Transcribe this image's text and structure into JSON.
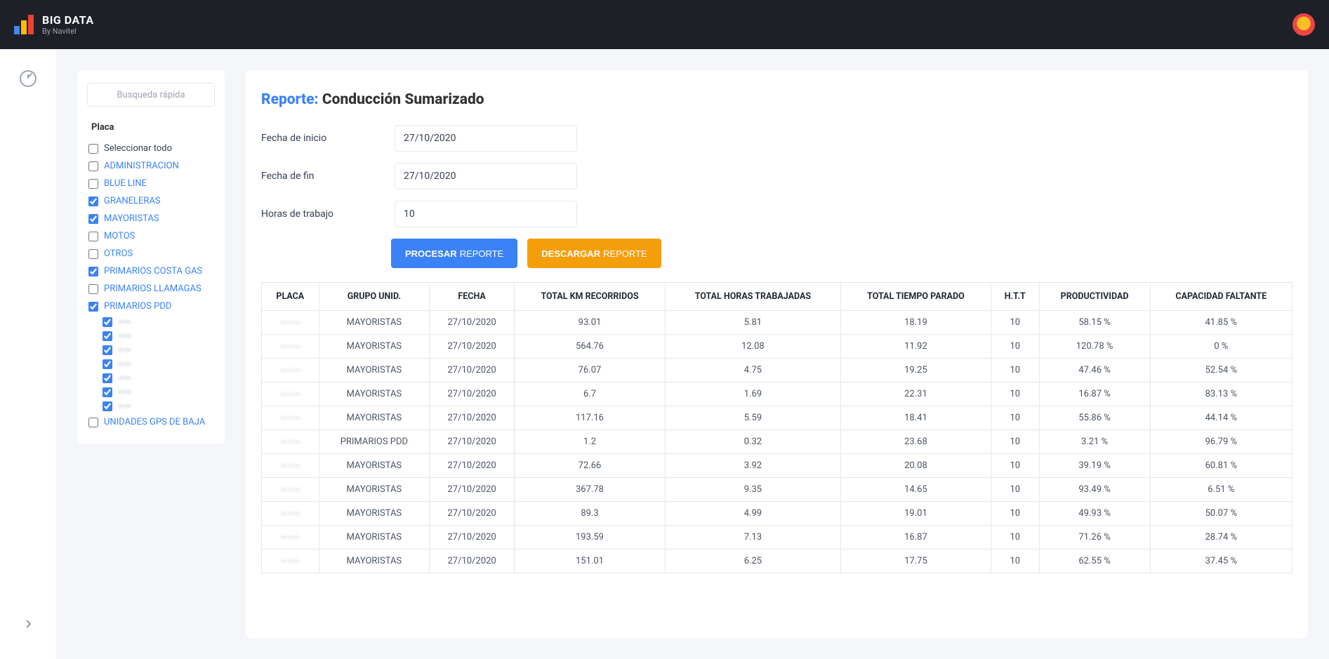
{
  "header": {
    "title": "BIG DATA",
    "subtitle": "By Navitel"
  },
  "search": {
    "placeholder": "Busqueda rápida"
  },
  "filter": {
    "title": "Placa",
    "select_all_label": "Seleccionar todo",
    "items": [
      {
        "label": "ADMINISTRACION",
        "checked": false
      },
      {
        "label": "BLUE LINE",
        "checked": false
      },
      {
        "label": "GRANELERAS",
        "checked": true
      },
      {
        "label": "MAYORISTAS",
        "checked": true
      },
      {
        "label": "MOTOS",
        "checked": false
      },
      {
        "label": "OTROS",
        "checked": false
      },
      {
        "label": "PRIMARIOS COSTA GAS",
        "checked": true
      },
      {
        "label": "PRIMARIOS LLAMAGAS",
        "checked": false
      },
      {
        "label": "PRIMARIOS PDD",
        "checked": true
      }
    ],
    "sub_items": [
      {
        "label": "——",
        "checked": true
      },
      {
        "label": "——",
        "checked": true
      },
      {
        "label": "——",
        "checked": true
      },
      {
        "label": "——",
        "checked": true
      },
      {
        "label": "——",
        "checked": true
      },
      {
        "label": "——",
        "checked": true
      },
      {
        "label": "——",
        "checked": true
      }
    ],
    "last_item": {
      "label": "UNIDADES GPS DE BAJA",
      "checked": false
    }
  },
  "report": {
    "prefix": "Reporte:",
    "name": "Conducción Sumarizado",
    "form": {
      "start_label": "Fecha de inicio",
      "start_value": "27/10/2020",
      "end_label": "Fecha de fin",
      "end_value": "27/10/2020",
      "hours_label": "Horas de trabajo",
      "hours_value": "10"
    },
    "buttons": {
      "process_bold": "PROCESAR",
      "process_light": "REPORTE",
      "download_bold": "DESCARGAR",
      "download_light": "REPORTE"
    }
  },
  "table": {
    "headers": [
      "PLACA",
      "GRUPO UNID.",
      "FECHA",
      "TOTAL KM RECORRIDOS",
      "TOTAL HORAS TRABAJADAS",
      "TOTAL TIEMPO PARADO",
      "H.T.T",
      "PRODUCTIVIDAD",
      "CAPACIDAD FALTANTE"
    ],
    "rows": [
      {
        "placa": "———",
        "grupo": "MAYORISTAS",
        "fecha": "27/10/2020",
        "km": "93.01",
        "horas": "5.81",
        "parado": "18.19",
        "htt": "10",
        "prod": "58.15 %",
        "cap": "41.85 %"
      },
      {
        "placa": "———",
        "grupo": "MAYORISTAS",
        "fecha": "27/10/2020",
        "km": "564.76",
        "horas": "12.08",
        "parado": "11.92",
        "htt": "10",
        "prod": "120.78 %",
        "cap": "0 %"
      },
      {
        "placa": "———",
        "grupo": "MAYORISTAS",
        "fecha": "27/10/2020",
        "km": "76.07",
        "horas": "4.75",
        "parado": "19.25",
        "htt": "10",
        "prod": "47.46 %",
        "cap": "52.54 %"
      },
      {
        "placa": "———",
        "grupo": "MAYORISTAS",
        "fecha": "27/10/2020",
        "km": "6.7",
        "horas": "1.69",
        "parado": "22.31",
        "htt": "10",
        "prod": "16.87 %",
        "cap": "83.13 %"
      },
      {
        "placa": "———",
        "grupo": "MAYORISTAS",
        "fecha": "27/10/2020",
        "km": "117.16",
        "horas": "5.59",
        "parado": "18.41",
        "htt": "10",
        "prod": "55.86 %",
        "cap": "44.14 %"
      },
      {
        "placa": "———",
        "grupo": "PRIMARIOS PDD",
        "fecha": "27/10/2020",
        "km": "1.2",
        "horas": "0.32",
        "parado": "23.68",
        "htt": "10",
        "prod": "3.21 %",
        "cap": "96.79 %"
      },
      {
        "placa": "———",
        "grupo": "MAYORISTAS",
        "fecha": "27/10/2020",
        "km": "72.66",
        "horas": "3.92",
        "parado": "20.08",
        "htt": "10",
        "prod": "39.19 %",
        "cap": "60.81 %"
      },
      {
        "placa": "———",
        "grupo": "MAYORISTAS",
        "fecha": "27/10/2020",
        "km": "367.78",
        "horas": "9.35",
        "parado": "14.65",
        "htt": "10",
        "prod": "93.49 %",
        "cap": "6.51 %"
      },
      {
        "placa": "———",
        "grupo": "MAYORISTAS",
        "fecha": "27/10/2020",
        "km": "89.3",
        "horas": "4.99",
        "parado": "19.01",
        "htt": "10",
        "prod": "49.93 %",
        "cap": "50.07 %"
      },
      {
        "placa": "———",
        "grupo": "MAYORISTAS",
        "fecha": "27/10/2020",
        "km": "193.59",
        "horas": "7.13",
        "parado": "16.87",
        "htt": "10",
        "prod": "71.26 %",
        "cap": "28.74 %"
      },
      {
        "placa": "———",
        "grupo": "MAYORISTAS",
        "fecha": "27/10/2020",
        "km": "151.01",
        "horas": "6.25",
        "parado": "17.75",
        "htt": "10",
        "prod": "62.55 %",
        "cap": "37.45 %"
      }
    ]
  }
}
